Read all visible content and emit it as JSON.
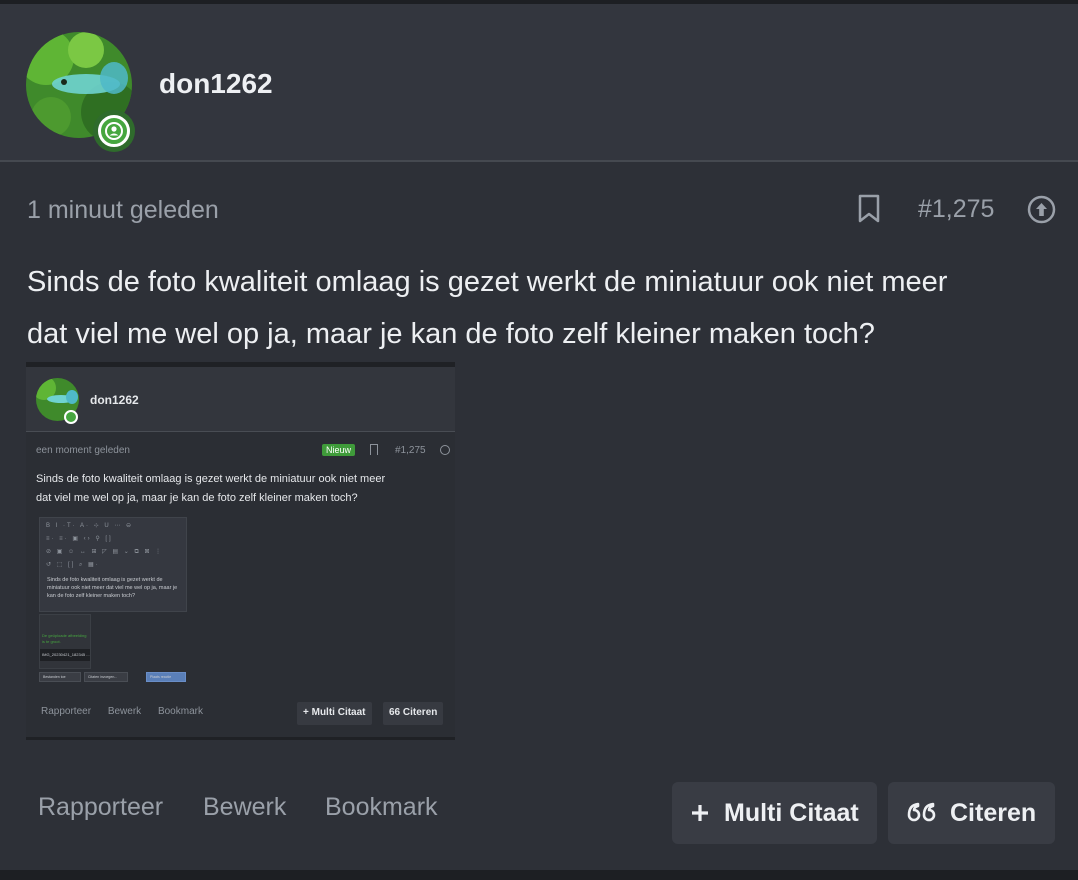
{
  "post": {
    "username": "don1262",
    "time": "1 minuut geleden",
    "post_number": "#1,275",
    "text_line1": "Sinds de foto kwaliteit omlaag is gezet werkt de miniatuur ook niet meer",
    "text_line2": "dat viel me wel op ja, maar je kan de foto zelf kleiner maken toch?"
  },
  "embedded_screenshot": {
    "username": "don1262",
    "time": "een moment geleden",
    "badge": "Nieuw",
    "post_number": "#1,275",
    "text_line1": "Sinds de foto kwaliteit omlaag is gezet werkt de miniatuur ook niet meer",
    "text_line2": "dat viel me wel op ja, maar je kan de foto zelf kleiner maken toch?",
    "editor_toolbar_row1": "B I ·T· A· ⊹ U ⋯ ⊖",
    "editor_toolbar_row2": "≡· ≡· ▣ ‹› ⚲ []",
    "editor_toolbar_row3": "⊘ ▣ ☺ ↔ ⊞ ◸ ▤ ⌄ ⧉ ⊠ ⋮",
    "editor_toolbar_row4": "↺ ⬚ [] ⌕ ▦·",
    "editor_text": "Sinds de foto kwaliteit omlaag is gezet werkt de miniatuur ook niet meer dat viel me wel op ja, maar je kan de foto zelf kleiner maken toch?",
    "attachment_label": "De geüploade afbeelding is te groot.",
    "attachment_file": "IMG_20230421_182345 ...",
    "btn_attach": "Bestanden toe",
    "btn_quote": "Citaten invoegen...",
    "btn_post": "Plaats reactie",
    "action_report": "Rapporteer",
    "action_edit": "Bewerk",
    "action_bookmark": "Bookmark",
    "btn_multi_quote": "+ Multi Citaat",
    "btn_quote_main": "Citeren"
  },
  "actions": {
    "report": "Rapporteer",
    "edit": "Bewerk",
    "bookmark": "Bookmark",
    "multi_quote": "Multi Citaat",
    "quote": "Citeren"
  },
  "colors": {
    "background": "#2d3037",
    "header": "#33363e",
    "online": "#46a63f",
    "button": "#393c44",
    "muted_text": "#9aa0a9"
  }
}
